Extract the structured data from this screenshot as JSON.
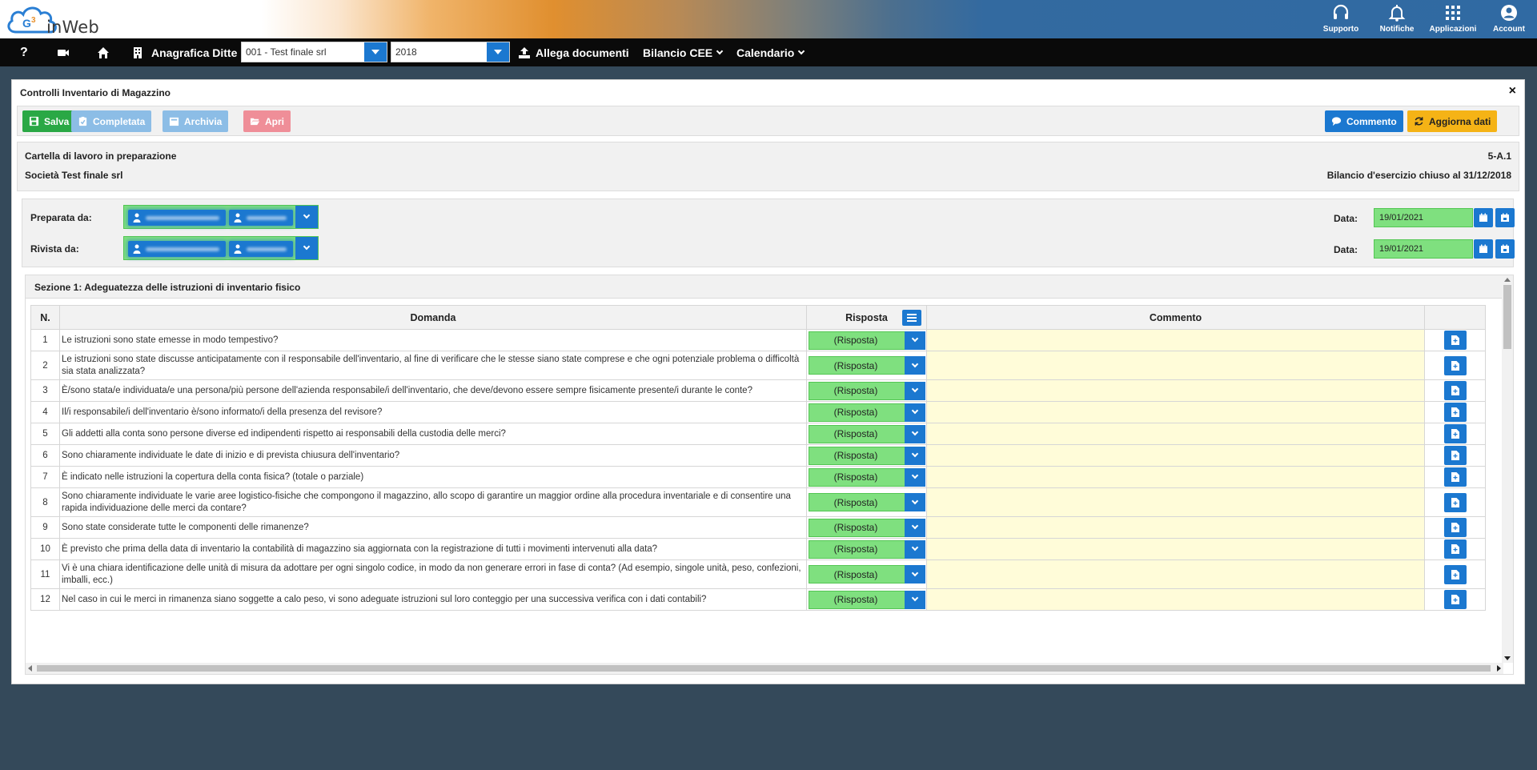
{
  "app": {
    "logo_text": "inWeb"
  },
  "top_icons": [
    {
      "icon": "headset-icon",
      "label": "Supporto"
    },
    {
      "icon": "bell-icon",
      "label": "Notifiche"
    },
    {
      "icon": "grid-icon",
      "label": "Applicazioni"
    },
    {
      "icon": "account-icon",
      "label": "Account"
    }
  ],
  "nav": {
    "help": "?",
    "anagrafica_label": "Anagrafica Ditte",
    "company_select": "001 - Test finale srl",
    "year_select": "2018",
    "allega_label": "Allega documenti",
    "bilancio_label": "Bilancio CEE",
    "calendario_label": "Calendario"
  },
  "panel": {
    "title": "Controlli Inventario di Magazzino",
    "close": "×"
  },
  "toolbar": {
    "salva": "Salva",
    "completata": "Completata",
    "archivia": "Archivia",
    "apri": "Apri",
    "commento": "Commento",
    "aggiorna": "Aggiorna dati"
  },
  "info": {
    "status": "Cartella di lavoro in preparazione",
    "company": "Società Test finale srl",
    "code": "5-A.1",
    "period": "Bilancio d'esercizio chiuso al 31/12/2018"
  },
  "signoff": {
    "preparata_label": "Preparata da:",
    "rivista_label": "Rivista da:",
    "data_label": "Data:",
    "preparata_date": "19/01/2021",
    "rivista_date": "19/01/2021"
  },
  "section": {
    "title": "Sezione 1: Adeguatezza delle istruzioni di inventario fisico",
    "headers": {
      "n": "N.",
      "domanda": "Domanda",
      "risposta": "Risposta",
      "commento": "Commento"
    },
    "placeholder": "(Risposta)",
    "rows": [
      {
        "n": "1",
        "q": "Le istruzioni sono state emesse in modo tempestivo?"
      },
      {
        "n": "2",
        "q": "Le istruzioni sono state discusse anticipatamente con il responsabile dell'inventario, al fine di verificare che le stesse siano state comprese e che ogni potenziale problema o difficoltà sia stata analizzata?"
      },
      {
        "n": "3",
        "q": "È/sono stata/e individuata/e una persona/più persone dell'azienda responsabile/i dell'inventario, che deve/devono essere sempre fisicamente presente/i durante le conte?"
      },
      {
        "n": "4",
        "q": "Il/i responsabile/i dell'inventario è/sono informato/i della presenza del revisore?"
      },
      {
        "n": "5",
        "q": "Gli addetti alla conta sono persone diverse ed indipendenti rispetto ai responsabili della custodia delle merci?"
      },
      {
        "n": "6",
        "q": "Sono chiaramente individuate le date di inizio e di prevista chiusura dell'inventario?"
      },
      {
        "n": "7",
        "q": "È indicato nelle istruzioni la copertura della conta fisica? (totale o parziale)"
      },
      {
        "n": "8",
        "q": "Sono chiaramente individuate le varie aree logistico-fisiche che compongono il magazzino, allo scopo di garantire un maggior ordine alla procedura inventariale e di consentire una rapida individuazione delle merci da contare?"
      },
      {
        "n": "9",
        "q": "Sono state considerate tutte le componenti delle rimanenze?"
      },
      {
        "n": "10",
        "q": "È previsto che prima della data di inventario la contabilità di magazzino sia aggiornata con la registrazione di tutti i movimenti intervenuti alla data?"
      },
      {
        "n": "11",
        "q": "Vi è una chiara identificazione delle unità di misura da adottare per ogni singolo codice, in modo da non generare errori in fase di conta? (Ad esempio, singole unità, peso, confezioni, imballi, ecc.)"
      },
      {
        "n": "12",
        "q": "Nel caso in cui le merci in rimanenza siano soggette a calo peso, vi sono adeguate istruzioni sul loro conteggio per una successiva verifica con i dati contabili?"
      }
    ]
  }
}
